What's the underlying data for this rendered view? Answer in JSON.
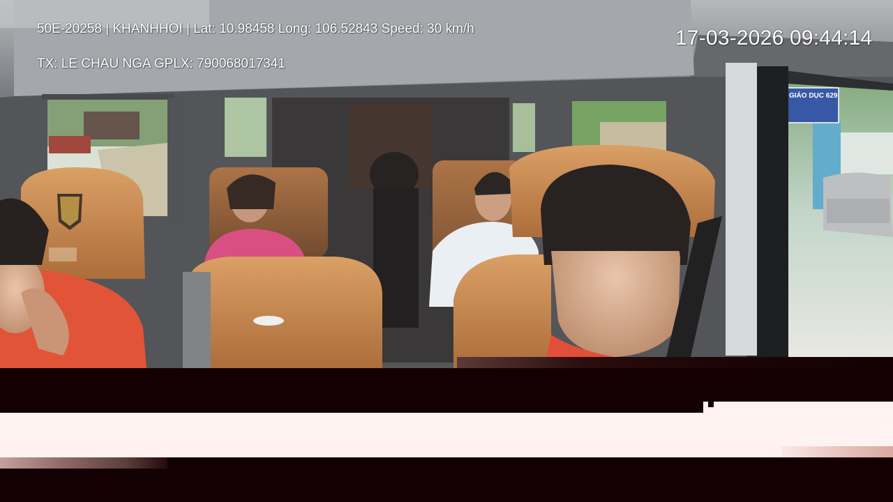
{
  "overlay": {
    "info_line": "50E-20258 | KHANHHOI | Lat: 10.98458 Long: 106.52843 Speed: 30 km/h",
    "driver_line": "TX: LE CHAU NGA GPLX: 790068017341",
    "timestamp": "17-03-2026 09:44:14"
  },
  "scene": {
    "sign_text": "GIÁO DỤC 629"
  },
  "colors": {
    "seat_leather": "#c98a4e",
    "roof_gray": "#8e9196",
    "glitch_dark": "#140002",
    "glitch_light": "#fff3f1"
  }
}
